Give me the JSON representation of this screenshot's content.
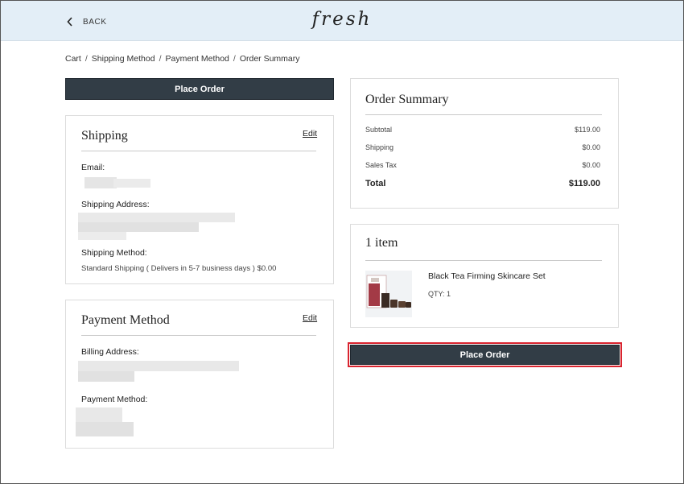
{
  "header": {
    "back_label": "BACK",
    "logo_text": "fresh"
  },
  "breadcrumb": [
    "Cart",
    "Shipping Method",
    "Payment Method",
    "Order Summary"
  ],
  "place_order_label": "Place Order",
  "shipping": {
    "title": "Shipping",
    "edit_label": "Edit",
    "email_label": "Email:",
    "address_label": "Shipping Address:",
    "method_label": "Shipping Method:",
    "method_value": "Standard Shipping ( Delivers in 5-7 business days ) $0.00"
  },
  "payment": {
    "title": "Payment Method",
    "edit_label": "Edit",
    "billing_label": "Billing Address:",
    "method_label": "Payment Method:"
  },
  "summary": {
    "title": "Order Summary",
    "rows": [
      {
        "label": "Subtotal",
        "value": "$119.00"
      },
      {
        "label": "Shipping",
        "value": "$0.00"
      },
      {
        "label": "Sales Tax",
        "value": "$0.00"
      }
    ],
    "total_label": "Total",
    "total_value": "$119.00"
  },
  "items": {
    "title": "1 item",
    "product_name": "Black Tea Firming Skincare Set",
    "qty": "QTY: 1"
  },
  "colors": {
    "header_bg": "#e3eef7",
    "button_bg": "#323d46",
    "highlight": "#d9242f"
  }
}
